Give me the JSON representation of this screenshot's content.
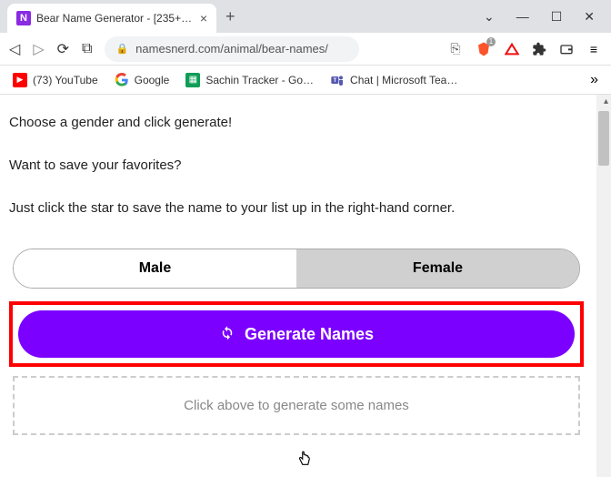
{
  "browser": {
    "tab_favicon": "N",
    "tab_title": "Bear Name Generator - [235+ am…",
    "url": "namesnerd.com/animal/bear-names/",
    "window_dropdown": "⌄",
    "window_min": "—",
    "window_max": "☐",
    "window_close": "✕"
  },
  "bookmarks": {
    "youtube": "(73) YouTube",
    "google": "Google",
    "sheets": "Sachin Tracker - Go…",
    "teams": "Chat | Microsoft Tea…",
    "more": "»"
  },
  "page": {
    "line1": "Choose a gender and click generate!",
    "line2": "Want to save your favorites?",
    "line3": "Just click the star to save the name to your list up in the right-hand corner.",
    "male_label": "Male",
    "female_label": "Female",
    "generate_label": "Generate Names",
    "results_placeholder": "Click above to generate some names"
  }
}
